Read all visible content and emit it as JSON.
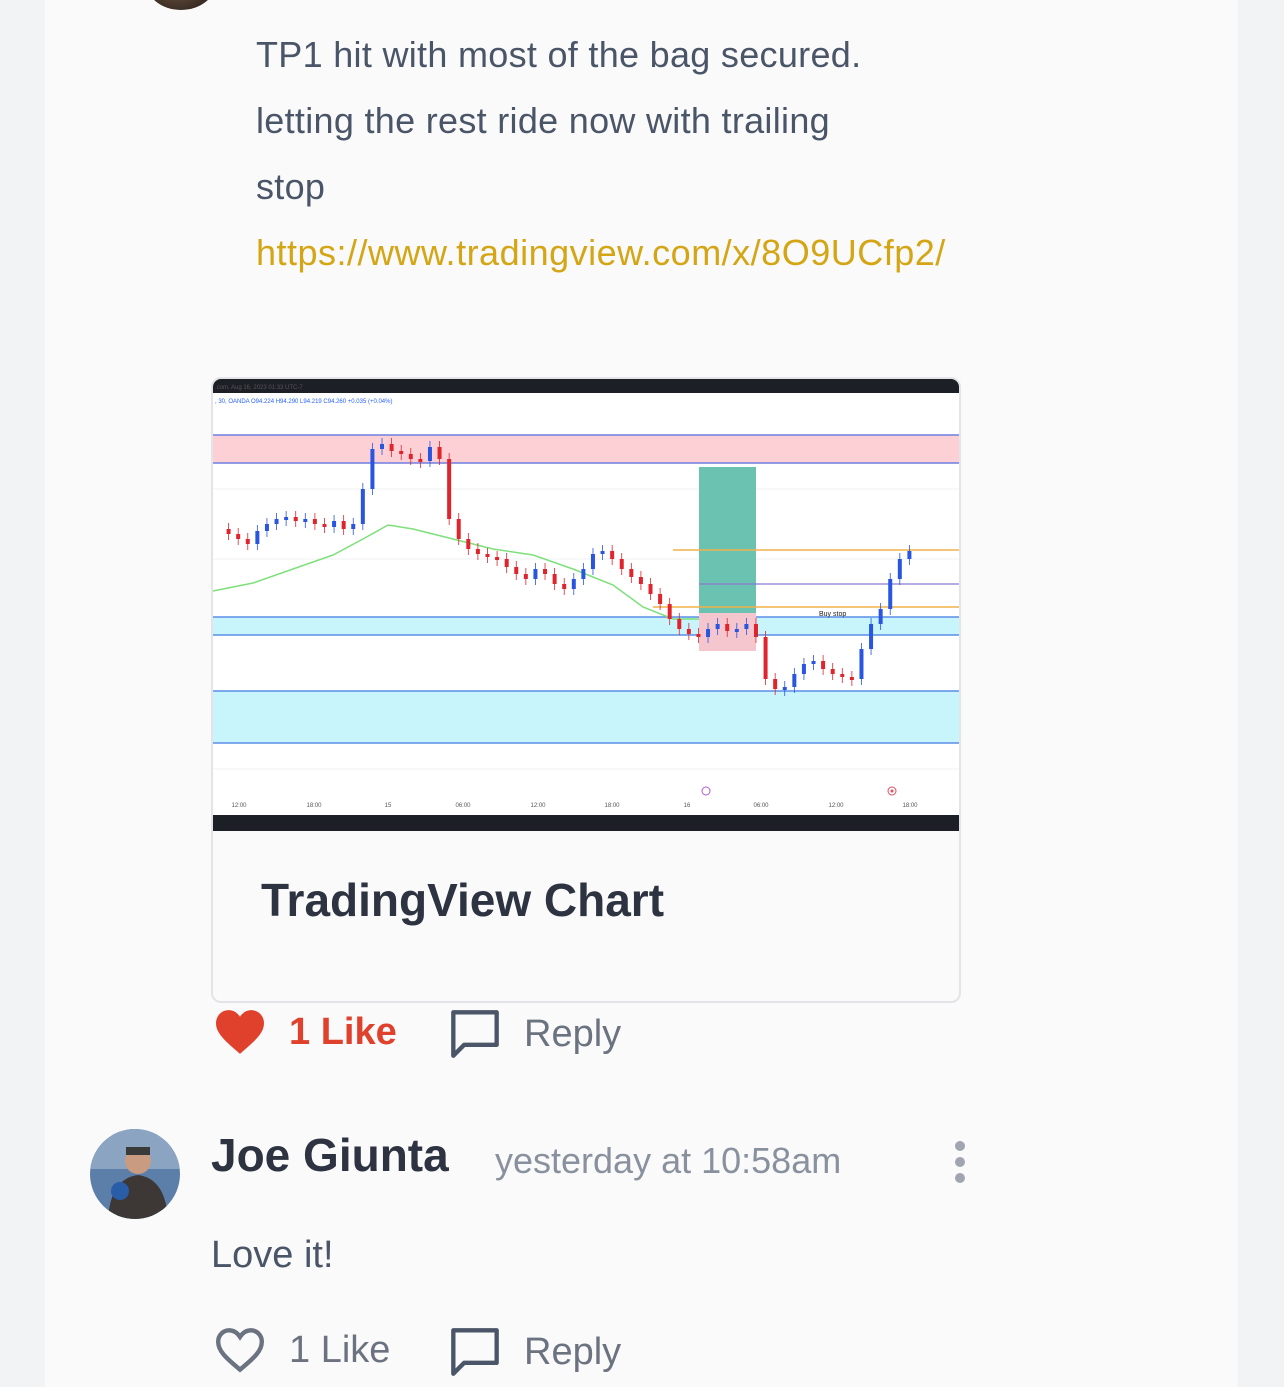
{
  "post": {
    "lines": [
      "TP1 hit with most of the bag secured.",
      "letting the rest ride now with trailing",
      "stop"
    ],
    "link": "https://www.tradingview.com/x/8O9UCfp2/",
    "embed": {
      "title": "TradingView Chart",
      "chart_header": ".com, Aug 16, 2023 01:33 UTC-7",
      "chart_ohlc": ", 30, OANDA  O94.224  H94.290  L94.219  C94.260  +0.035 (+0.04%)",
      "x_ticks": [
        "12:00",
        "18:00",
        "15",
        "06:00",
        "12:00",
        "18:00",
        "16",
        "06:00",
        "12:00",
        "18:00"
      ],
      "annotation": "Buy stop"
    },
    "like_label": "1 Like",
    "reply_label": "Reply"
  },
  "comment": {
    "author": "Joe Giunta",
    "time": "yesterday at 10:58am",
    "text": "Love it!",
    "like_label": "1 Like",
    "reply_label": "Reply"
  },
  "colors": {
    "link": "#d4a514",
    "like_active": "#e0412d",
    "text": "#4a5568",
    "muted": "#6b7280"
  },
  "icons": [
    "heart-filled-icon",
    "reply-bubble-icon",
    "heart-outline-icon",
    "more-vertical-icon"
  ]
}
